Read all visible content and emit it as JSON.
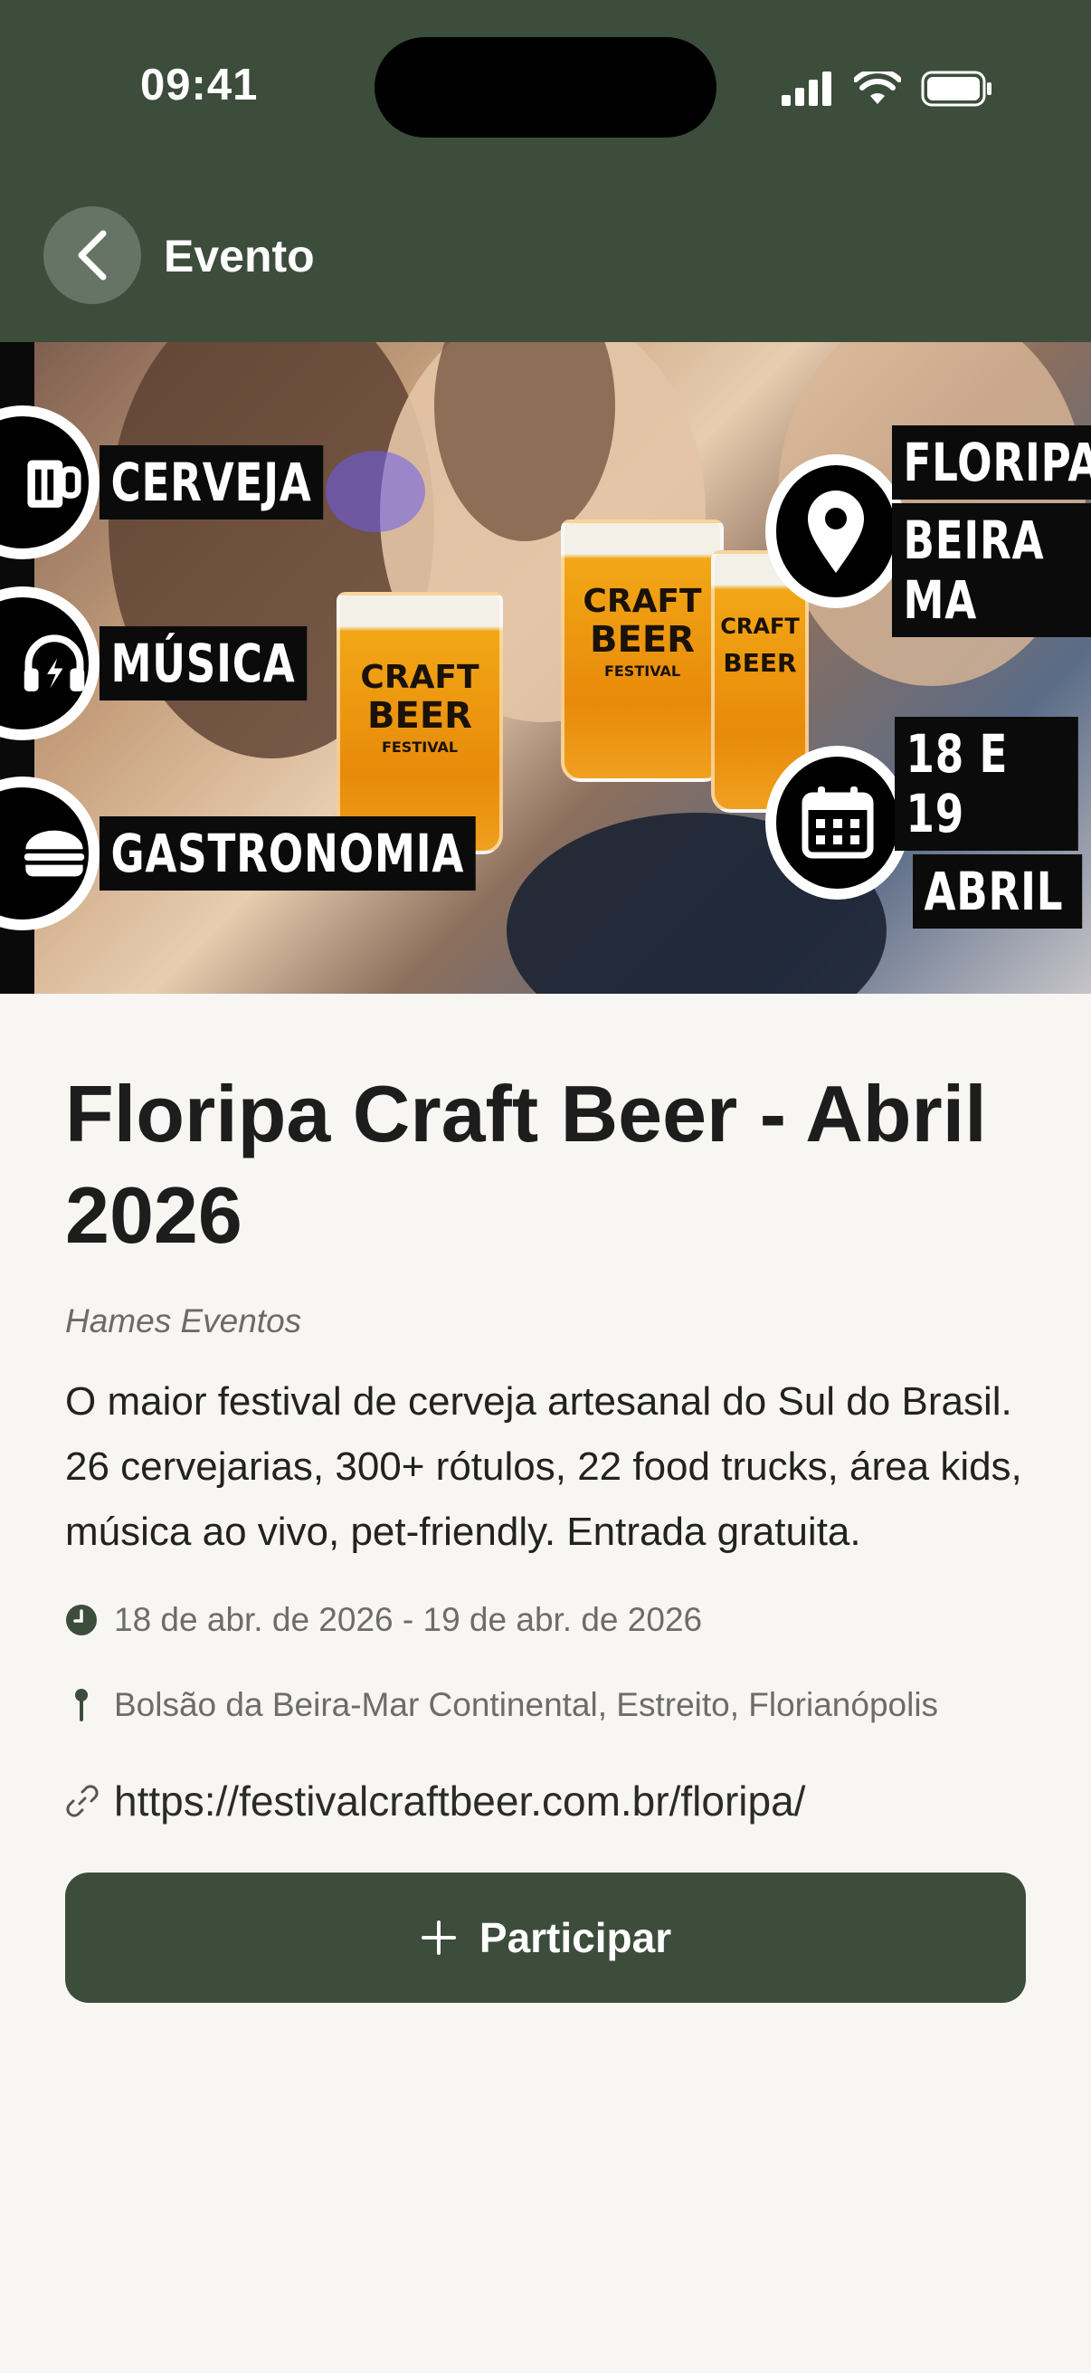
{
  "status_bar": {
    "time": "09:41"
  },
  "header": {
    "title": "Evento"
  },
  "hero": {
    "badges_left": [
      "CERVEJA",
      "MÚSICA",
      "GASTRONOMIA"
    ],
    "badge_place": [
      "FLORIPA",
      "BEIRA MA"
    ],
    "badge_date": [
      "18 E 19",
      "ABRIL"
    ],
    "glass_logo": [
      "CRAFT",
      "BEER",
      "FESTIVAL"
    ]
  },
  "event": {
    "title": "Floripa Craft Beer - Abril 2026",
    "organizer": "Hames Eventos",
    "description": "O maior festival de cerveja artesanal do Sul do Brasil. 26 cervejarias, 300+ rótulos, 22 food trucks, área kids, música ao vivo, pet-friendly. Entrada gratuita.",
    "date_range": "18 de abr. de 2026 - 19 de abr. de 2026",
    "location": "Bolsão da Beira-Mar Continental, Estreito, Florianópolis",
    "link": "https://festivalcraftbeer.com.br/floripa/"
  },
  "actions": {
    "participate_label": "Participar"
  },
  "colors": {
    "primary": "#3c4d3b",
    "background": "#f8f6f3",
    "text": "#1d1d1d",
    "muted": "#6c6c6c"
  },
  "icons": {
    "back": "chevron-left-icon",
    "date": "clock-icon",
    "location": "pin-icon",
    "link": "link-icon",
    "participate": "plus-icon"
  }
}
